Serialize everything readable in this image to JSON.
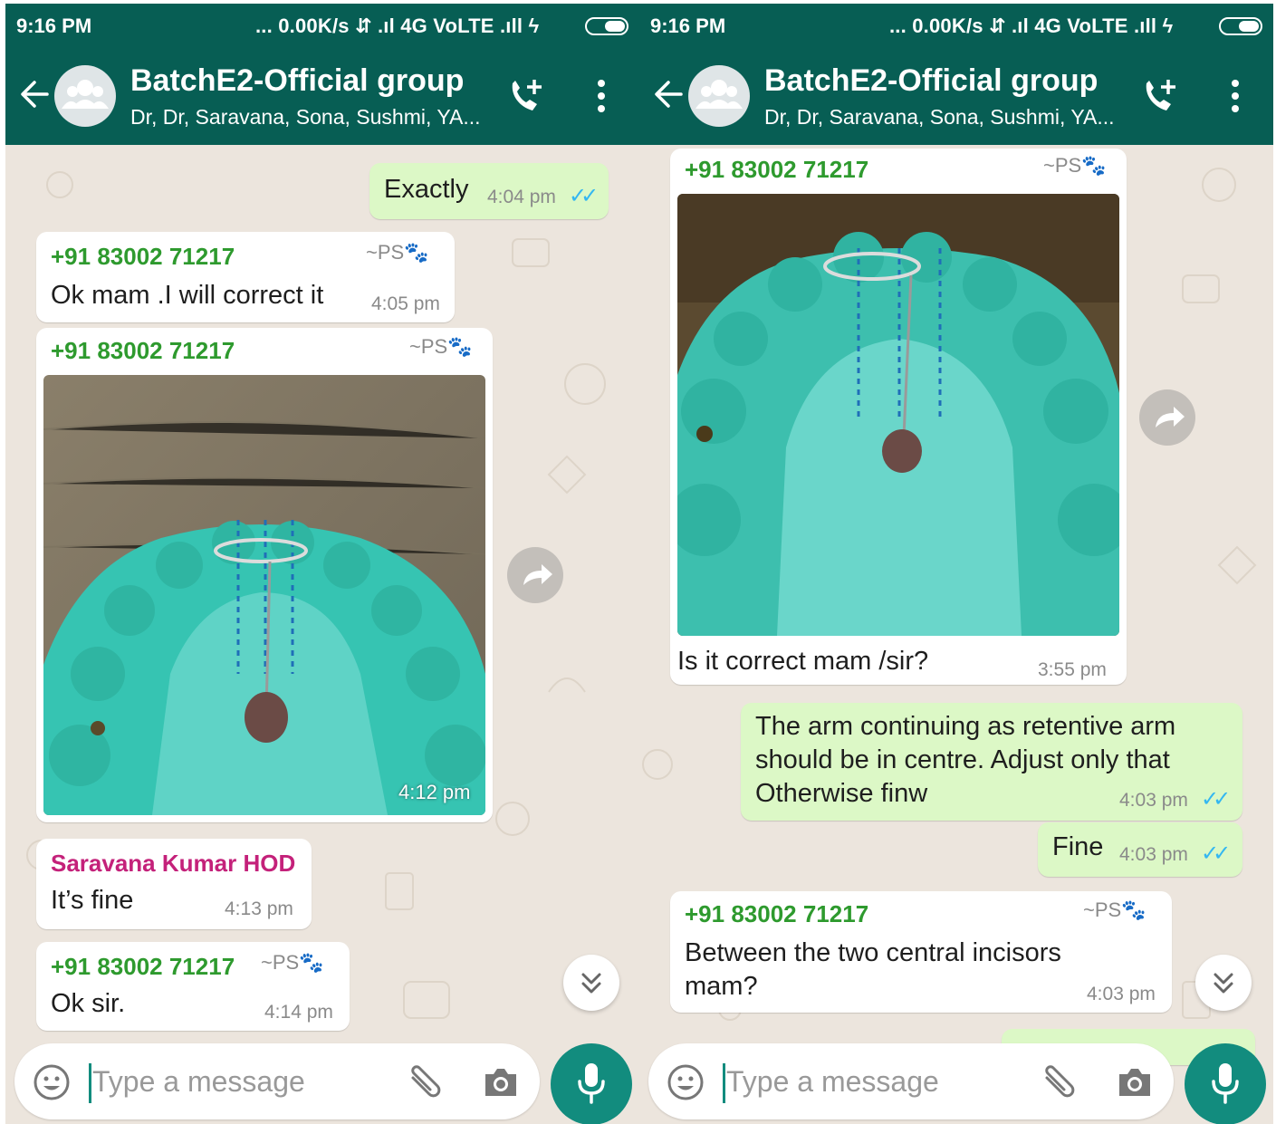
{
  "status": {
    "time": "9:16 PM",
    "network": "... 0.00K/s ⇵ .ıl 4G VoLTE .ıll ϟ"
  },
  "header": {
    "title": "BatchE2-Official group",
    "subtitle": "Dr, Dr, Saravana, Sona, Sushmi, YA..."
  },
  "composer": {
    "placeholder": "Type a message"
  },
  "left": {
    "messages": [
      {
        "text": "Exactly",
        "time": "4:04 pm"
      },
      {
        "sender": "+91 83002 71217",
        "handle": "~PS🐾",
        "text": "Ok mam .I will correct it",
        "time": "4:05 pm"
      },
      {
        "sender": "+91 83002 71217",
        "handle": "~PS🐾",
        "time": "4:12 pm"
      },
      {
        "sender": "Saravana Kumar HOD",
        "text": "It’s fine",
        "time": "4:13 pm"
      },
      {
        "sender": "+91 83002 71217",
        "handle": "~PS🐾",
        "text": "Ok sir.",
        "time": "4:14 pm"
      }
    ]
  },
  "right": {
    "messages": [
      {
        "sender": "+91 83002 71217",
        "handle": "~PS🐾",
        "text": "Is it correct mam /sir?",
        "time": "3:55 pm"
      },
      {
        "lines": [
          "The arm continuing as retentive arm",
          "should be in centre. Adjust only that",
          "Otherwise finw"
        ],
        "time": "4:03 pm"
      },
      {
        "text": "Fine",
        "time": "4:03 pm"
      },
      {
        "sender": "+91 83002 71217",
        "handle": "~PS🐾",
        "lines": [
          "Between the two central incisors",
          "mam?"
        ],
        "time": "4:03 pm"
      }
    ]
  },
  "colors": {
    "header": "#075e54",
    "accent": "#128c7e",
    "outgoing": "#dcf8c6",
    "incoming": "#ffffff",
    "wallpaper": "#ece5dd",
    "sender_green": "#2e9a2e",
    "sender_pink": "#c4217a",
    "read_ticks": "#34b7f1"
  },
  "icons": [
    "back-arrow-icon",
    "group-avatar-icon",
    "add-call-icon",
    "more-vert-icon",
    "forward-icon",
    "chevron-down-icon",
    "emoji-icon",
    "attach-icon",
    "camera-icon",
    "mic-icon",
    "read-ticks-icon"
  ]
}
